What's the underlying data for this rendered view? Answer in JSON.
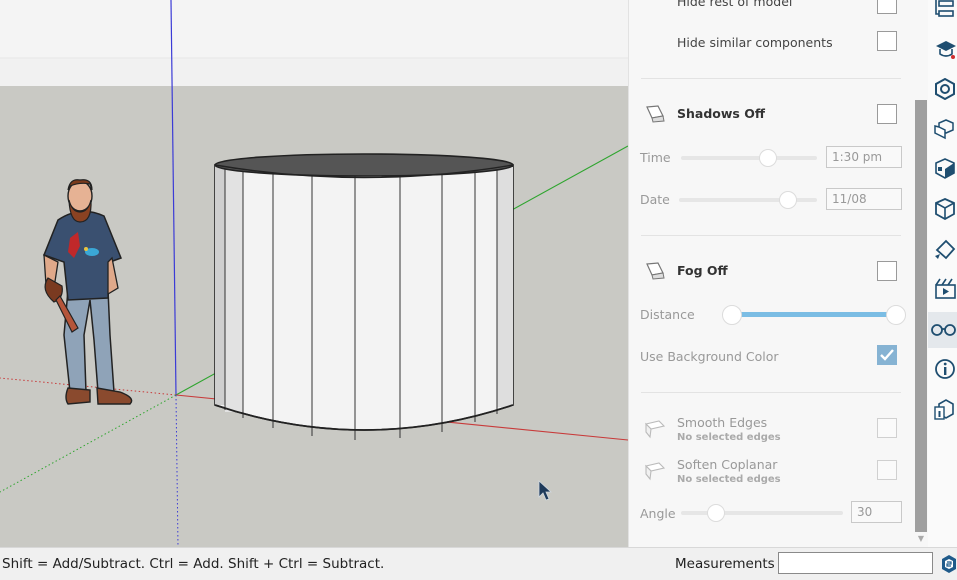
{
  "viewport": {
    "description_hidden": ""
  },
  "panel": {
    "hide_rest": {
      "label": "Hide rest of model"
    },
    "hide_similar": {
      "label": "Hide similar components"
    },
    "shadows": {
      "label": "Shadows Off",
      "enabled": false
    },
    "time": {
      "label": "Time",
      "value": "1:30 pm"
    },
    "date": {
      "label": "Date",
      "value": "11/08"
    },
    "fog": {
      "label": "Fog Off",
      "enabled": false
    },
    "distance": {
      "label": "Distance"
    },
    "use_bg": {
      "label": "Use Background Color",
      "checked": true
    },
    "smooth_edges": {
      "label": "Smooth Edges",
      "sub": "No selected edges"
    },
    "soften_coplanar": {
      "label": "Soften Coplanar",
      "sub": "No selected edges"
    },
    "angle": {
      "label": "Angle",
      "value": "30"
    }
  },
  "toolstrip": {
    "icons": [
      "outliner-icon",
      "instructor-icon",
      "materials-icon",
      "components-icon",
      "styles-icon",
      "tags-icon",
      "scenes-icon",
      "animation-icon",
      "display-icon",
      "entity-info-icon",
      "model-info-icon"
    ],
    "active": "display-icon"
  },
  "status": {
    "hint": "Shift = Add/Subtract. Ctrl = Add. Shift + Ctrl = Subtract.",
    "measurements_label": "Measurements",
    "measurements_value": ""
  }
}
